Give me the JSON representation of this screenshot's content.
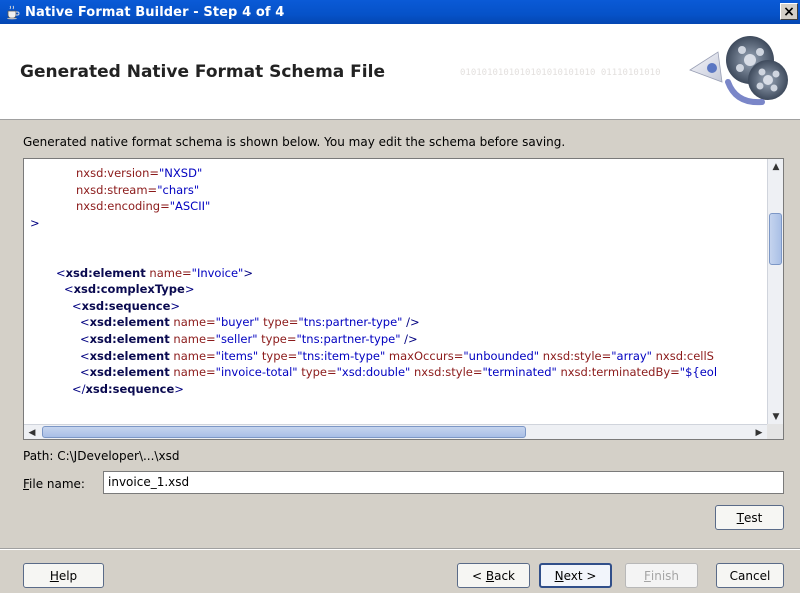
{
  "window": {
    "title": "Native Format Builder - Step 4 of 4",
    "close_label": "×"
  },
  "header": {
    "title": "Generated Native Format Schema File",
    "binary_text": "0101010101010101010101010 01110101010"
  },
  "instruction": "Generated native format schema is shown below. You may edit the schema before saving.",
  "editor": {
    "lines": [
      {
        "indent": 4,
        "parts": [
          {
            "t": "attr",
            "v": "nxsd:version="
          },
          {
            "t": "val",
            "v": "\"NXSD\""
          }
        ]
      },
      {
        "indent": 4,
        "parts": [
          {
            "t": "attr",
            "v": "nxsd:stream="
          },
          {
            "t": "val",
            "v": "\"chars\""
          }
        ]
      },
      {
        "indent": 4,
        "parts": [
          {
            "t": "attr",
            "v": "nxsd:encoding="
          },
          {
            "t": "val",
            "v": "\"ASCII\""
          }
        ]
      },
      {
        "indent": 0,
        "parts": [
          {
            "t": "tag",
            "v": ">"
          }
        ]
      },
      {
        "indent": 0,
        "parts": []
      },
      {
        "indent": 0,
        "parts": []
      },
      {
        "indent": 1,
        "parts": [
          {
            "t": "tag",
            "v": "<"
          },
          {
            "t": "tagb",
            "v": "xsd:element"
          },
          {
            "t": "attr",
            "v": " name="
          },
          {
            "t": "val",
            "v": "\"Invoice\""
          },
          {
            "t": "tag",
            "v": ">"
          }
        ]
      },
      {
        "indent": 2,
        "parts": [
          {
            "t": "tag",
            "v": "<"
          },
          {
            "t": "tagb",
            "v": "xsd:complexType"
          },
          {
            "t": "tag",
            "v": ">"
          }
        ]
      },
      {
        "indent": 3,
        "parts": [
          {
            "t": "tag",
            "v": "<"
          },
          {
            "t": "tagb",
            "v": "xsd:sequence"
          },
          {
            "t": "tag",
            "v": ">"
          }
        ]
      },
      {
        "indent": 4,
        "parts": [
          {
            "t": "tag",
            "v": "<"
          },
          {
            "t": "tagb",
            "v": "xsd:element"
          },
          {
            "t": "attr",
            "v": " name="
          },
          {
            "t": "val",
            "v": "\"buyer\""
          },
          {
            "t": "attr",
            "v": " type="
          },
          {
            "t": "val",
            "v": "\"tns:partner-type\""
          },
          {
            "t": "tag",
            "v": " />"
          }
        ]
      },
      {
        "indent": 4,
        "parts": [
          {
            "t": "tag",
            "v": "<"
          },
          {
            "t": "tagb",
            "v": "xsd:element"
          },
          {
            "t": "attr",
            "v": " name="
          },
          {
            "t": "val",
            "v": "\"seller\""
          },
          {
            "t": "attr",
            "v": " type="
          },
          {
            "t": "val",
            "v": "\"tns:partner-type\""
          },
          {
            "t": "tag",
            "v": " />"
          }
        ]
      },
      {
        "indent": 4,
        "parts": [
          {
            "t": "tag",
            "v": "<"
          },
          {
            "t": "tagb",
            "v": "xsd:element"
          },
          {
            "t": "attr",
            "v": " name="
          },
          {
            "t": "val",
            "v": "\"items\""
          },
          {
            "t": "attr",
            "v": " type="
          },
          {
            "t": "val",
            "v": "\"tns:item-type\""
          },
          {
            "t": "attr",
            "v": " maxOccurs="
          },
          {
            "t": "val",
            "v": "\"unbounded\""
          },
          {
            "t": "attr",
            "v": " nxsd:style="
          },
          {
            "t": "val",
            "v": "\"array\""
          },
          {
            "t": "attr",
            "v": " nxsd:cellS"
          }
        ]
      },
      {
        "indent": 4,
        "parts": [
          {
            "t": "tag",
            "v": "<"
          },
          {
            "t": "tagb",
            "v": "xsd:element"
          },
          {
            "t": "attr",
            "v": " name="
          },
          {
            "t": "val",
            "v": "\"invoice-total\""
          },
          {
            "t": "attr",
            "v": " type="
          },
          {
            "t": "val",
            "v": "\"xsd:double\""
          },
          {
            "t": "attr",
            "v": " nxsd:style="
          },
          {
            "t": "val",
            "v": "\"terminated\""
          },
          {
            "t": "attr",
            "v": " nxsd:terminatedBy="
          },
          {
            "t": "val",
            "v": "\"${eol"
          }
        ]
      },
      {
        "indent": 3,
        "parts": [
          {
            "t": "tag",
            "v": "</"
          },
          {
            "t": "tagb",
            "v": "xsd:sequence"
          },
          {
            "t": "tag",
            "v": ">"
          }
        ]
      }
    ]
  },
  "path": "Path: C:\\JDeveloper\\...\\xsd",
  "file": {
    "label_mnemonic": "F",
    "label_rest": "ile name:",
    "value": "invoice_1.xsd"
  },
  "buttons": {
    "test": {
      "mn": "T",
      "rest": "est"
    },
    "help": {
      "mn": "H",
      "rest": "elp"
    },
    "back": {
      "pre": "< ",
      "mn": "B",
      "rest": "ack"
    },
    "next": {
      "mn": "N",
      "rest": "ext >"
    },
    "finish": {
      "mn": "F",
      "rest": "inish"
    },
    "cancel": {
      "label": "Cancel"
    }
  },
  "colors": {
    "titlebar": "#0652c8",
    "dialog_bg": "#d4d0c8",
    "attr": "#8b1a1a",
    "value": "#0000c0",
    "tag": "#000080"
  }
}
